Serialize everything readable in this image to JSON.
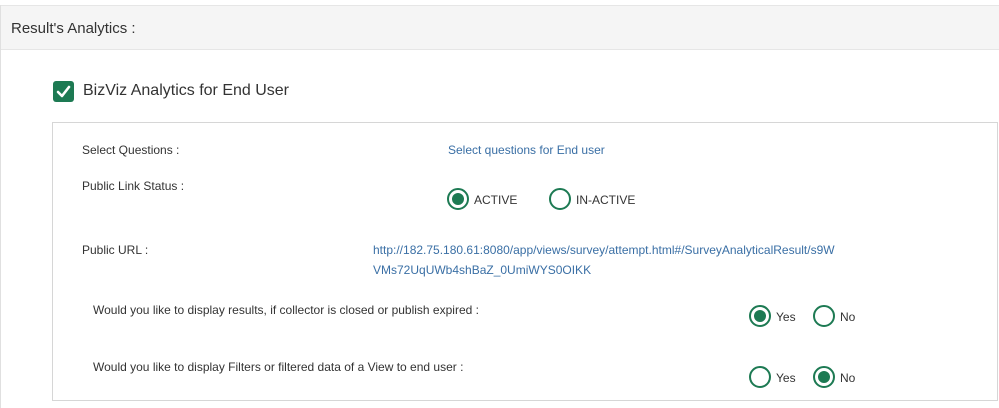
{
  "header": {
    "title": "Result's Analytics :"
  },
  "end_user": {
    "checkbox_label": "BizViz Analytics for End User",
    "checked": true
  },
  "rows": {
    "select_questions": {
      "label": "Select Questions :",
      "link": "Select questions for End user"
    },
    "public_link_status": {
      "label": "Public Link Status :",
      "options": [
        "ACTIVE",
        "IN-ACTIVE"
      ],
      "selected": "ACTIVE"
    },
    "public_url": {
      "label": "Public URL :",
      "url_line1": "http://182.75.180.61:8080/app/views/survey/attempt.html#/SurveyAnalyticalResult/s9W",
      "url_line2": "VMs72UqUWb4shBaZ_0UmiWYS0OIKK"
    },
    "display_results": {
      "label": "Would you like to display results, if collector is closed or publish expired :",
      "options": [
        "Yes",
        "No"
      ],
      "selected": "Yes"
    },
    "display_filters": {
      "label": "Would you like to display Filters or filtered data of a View to end user :",
      "options": [
        "Yes",
        "No"
      ],
      "selected": "No"
    }
  },
  "colors": {
    "accent": "#1d7a53",
    "link": "#3a6fa5"
  }
}
